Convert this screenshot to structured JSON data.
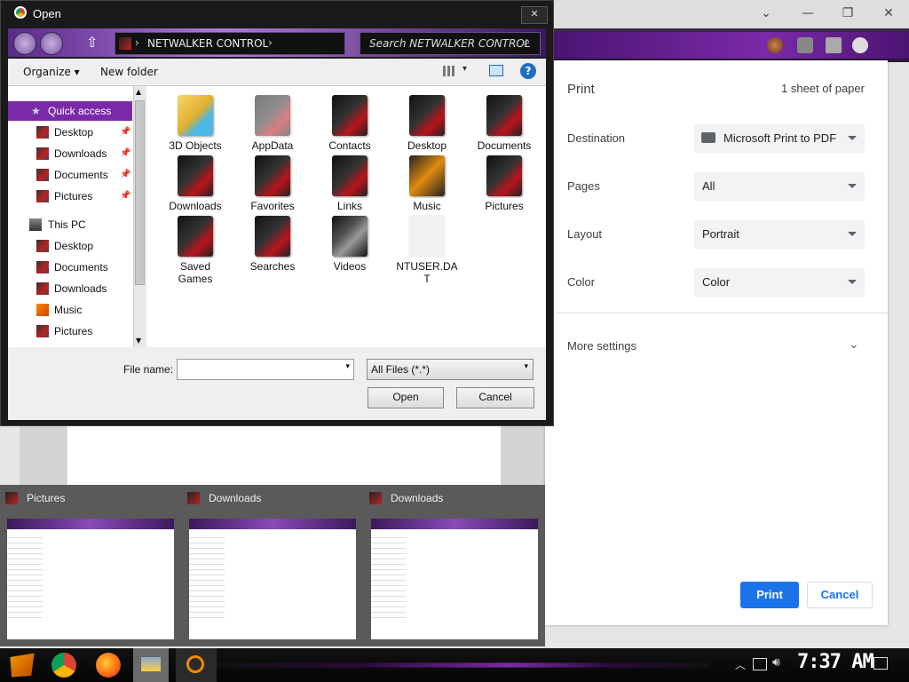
{
  "chrome": {
    "print_panel": {
      "title": "Print",
      "sheet_count": "1 sheet of paper",
      "rows": [
        {
          "label": "Destination",
          "value": "Microsoft Print to PDF"
        },
        {
          "label": "Pages",
          "value": "All"
        },
        {
          "label": "Layout",
          "value": "Portrait"
        },
        {
          "label": "Color",
          "value": "Color"
        }
      ],
      "more_settings": "More settings",
      "print_button": "Print",
      "cancel_button": "Cancel"
    },
    "accent_color": "#1a73e8"
  },
  "dialog": {
    "title": "Open",
    "close_glyph": "✕",
    "address_path": "NETWALKER CONTROL",
    "search_placeholder": "Search NETWALKER CONTROL",
    "toolbar": {
      "organize": "Organize ▾",
      "new_folder": "New folder",
      "help_glyph": "?"
    },
    "nav": {
      "quick_access": "Quick access",
      "quick_items": [
        "Desktop",
        "Downloads",
        "Documents",
        "Pictures"
      ],
      "this_pc": "This PC",
      "pc_items": [
        "Desktop",
        "Documents",
        "Downloads",
        "Music",
        "Pictures"
      ]
    },
    "files": [
      [
        "3D Objects",
        "AppData",
        "Contacts",
        "Desktop",
        "Documents"
      ],
      [
        "Downloads",
        "Favorites",
        "Links",
        "Music",
        "Pictures"
      ],
      [
        "Saved Games",
        "Searches",
        "Videos",
        "NTUSER.DAT"
      ]
    ],
    "filename_label": "File name:",
    "filename_value": "",
    "filetype_value": "All Files (*.*)",
    "open_button": "Open",
    "cancel_button": "Cancel"
  },
  "thumbnails": [
    {
      "title": "Pictures"
    },
    {
      "title": "Downloads"
    },
    {
      "title": "Downloads"
    }
  ],
  "taskbar": {
    "clock": "7:37 AM",
    "apps": [
      "start-icon",
      "chrome-icon",
      "firefox-icon",
      "explorer-icon",
      "search-icon"
    ]
  }
}
